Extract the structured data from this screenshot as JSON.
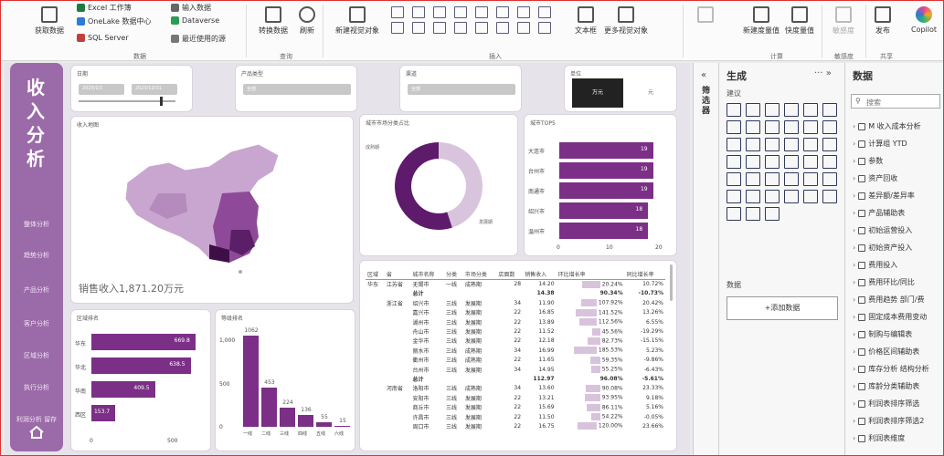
{
  "ribbon": {
    "get_data": "获取数据",
    "excel": "Excel 工作簿",
    "onelake": "OneLake 数据中心",
    "sql": "SQL Server",
    "enter_data": "输入数据",
    "dataverse": "Dataverse",
    "recent": "最近使用的源",
    "group_data": "数据",
    "transform": "转换数据",
    "refresh": "刷新",
    "group_query": "查询",
    "new_visual": "新建视觉对象",
    "group_insert": "插入",
    "textbox": "文本框",
    "more_visuals": "更多视觉对象",
    "quick_measure": "新建度量值",
    "quick_measure2": "快度量值",
    "group_calc": "计算",
    "sensitivity": "敏感度",
    "group_sens": "敏感度",
    "publish": "发布",
    "group_share": "共享",
    "copilot": "Copilot"
  },
  "nav": {
    "title": [
      "收",
      "入",
      "分",
      "析"
    ],
    "items": [
      "整体分析",
      "趋势分析",
      "产品分析",
      "客户分析",
      "区域分析",
      "执行分析",
      "利润分析 留存"
    ]
  },
  "slicers": {
    "date": {
      "title": "日期",
      "from": "2023/1/1",
      "to": "2023/12/31"
    },
    "product": {
      "title": "产品类型",
      "value": "全部"
    },
    "channel": {
      "title": "渠道",
      "value": "全部"
    },
    "unit": {
      "title": "单位",
      "selected": "万元",
      "other": "元"
    }
  },
  "map_card": {
    "title": "收入地图",
    "total_label": "销售收入1,871.20万元"
  },
  "donut_card": {
    "title": "城市市场分类占比",
    "label_a": "成熟期",
    "label_b": "发展期"
  },
  "top5_card": {
    "title": "城市TOP5"
  },
  "region_card": {
    "title": "区域排名"
  },
  "level_card": {
    "title": "等级排名"
  },
  "chart_data": [
    {
      "type": "bar",
      "title": "城市TOP5",
      "categories": [
        "大连市",
        "台州市",
        "南通市",
        "绍兴市",
        "温州市"
      ],
      "values": [
        19,
        19,
        19,
        18,
        18
      ],
      "xlim": [
        0,
        20
      ],
      "x_ticks": [
        "0",
        "10",
        "20"
      ]
    },
    {
      "type": "bar",
      "title": "区域排名",
      "categories": [
        "华东",
        "华北",
        "华南",
        "西区"
      ],
      "values": [
        669.8,
        638.5,
        409.5,
        153.7
      ],
      "x_ticks": [
        "0",
        "500"
      ]
    },
    {
      "type": "bar",
      "title": "等级排名",
      "categories": [
        "一线",
        "二线",
        "三线",
        "四线",
        "五线",
        "六线"
      ],
      "values": [
        1062,
        453,
        224,
        136,
        55,
        15
      ],
      "y_ticks": [
        "1,000",
        "500",
        "0"
      ],
      "ylim": [
        0,
        1100
      ]
    },
    {
      "type": "pie",
      "title": "城市市场分类占比",
      "categories": [
        "成熟期",
        "发展期"
      ],
      "values": [
        45,
        55
      ]
    }
  ],
  "table": {
    "headers": [
      "区域",
      "省",
      "城市名称",
      "分类",
      "市场分类",
      "店面数",
      "销售收入",
      "环比增长率",
      "同比增长率"
    ],
    "rows": [
      {
        "region": "华东",
        "prov": "江苏省",
        "city": "无锡市",
        "tier": "一线",
        "stage": "成熟期",
        "stores": "28",
        "rev": "14.20",
        "mom": "20.24%",
        "yoy": "10.72%",
        "w": 40
      },
      {
        "region": "",
        "prov": "",
        "city": "总计",
        "tier": "",
        "stage": "",
        "stores": "",
        "rev": "14.38",
        "mom": "90.34%",
        "yoy": "-10.73%",
        "w": 0,
        "sub": true
      },
      {
        "region": "",
        "prov": "浙江省",
        "city": "绍兴市",
        "tier": "三线",
        "stage": "发展期",
        "stores": "34",
        "rev": "11.90",
        "mom": "107.92%",
        "yoy": "20.42%",
        "w": 34
      },
      {
        "region": "",
        "prov": "",
        "city": "嘉兴市",
        "tier": "三线",
        "stage": "发展期",
        "stores": "22",
        "rev": "16.85",
        "mom": "141.52%",
        "yoy": "13.26%",
        "w": 46
      },
      {
        "region": "",
        "prov": "",
        "city": "湖州市",
        "tier": "三线",
        "stage": "发展期",
        "stores": "22",
        "rev": "13.89",
        "mom": "112.56%",
        "yoy": "6.55%",
        "w": 38
      },
      {
        "region": "",
        "prov": "",
        "city": "舟山市",
        "tier": "三线",
        "stage": "发展期",
        "stores": "22",
        "rev": "11.52",
        "mom": "45.56%",
        "yoy": "-19.29%",
        "w": 18
      },
      {
        "region": "",
        "prov": "",
        "city": "金华市",
        "tier": "三线",
        "stage": "发展期",
        "stores": "22",
        "rev": "12.18",
        "mom": "82.73%",
        "yoy": "-15.15%",
        "w": 28
      },
      {
        "region": "",
        "prov": "",
        "city": "丽水市",
        "tier": "三线",
        "stage": "成熟期",
        "stores": "34",
        "rev": "16.99",
        "mom": "185.53%",
        "yoy": "5.23%",
        "w": 50
      },
      {
        "region": "",
        "prov": "",
        "city": "衢州市",
        "tier": "三线",
        "stage": "成熟期",
        "stores": "22",
        "rev": "11.65",
        "mom": "59.35%",
        "yoy": "-9.86%",
        "w": 22
      },
      {
        "region": "",
        "prov": "",
        "city": "台州市",
        "tier": "三线",
        "stage": "发展期",
        "stores": "34",
        "rev": "14.95",
        "mom": "55.25%",
        "yoy": "-6.43%",
        "w": 20
      },
      {
        "region": "",
        "prov": "",
        "city": "总计",
        "tier": "",
        "stage": "",
        "stores": "",
        "rev": "112.97",
        "mom": "96.08%",
        "yoy": "-5.61%",
        "w": 0,
        "sub": true
      },
      {
        "region": "",
        "prov": "河南省",
        "city": "洛阳市",
        "tier": "三线",
        "stage": "成熟期",
        "stores": "34",
        "rev": "13.60",
        "mom": "90.08%",
        "yoy": "23.33%",
        "w": 32
      },
      {
        "region": "",
        "prov": "",
        "city": "安阳市",
        "tier": "三线",
        "stage": "发展期",
        "stores": "22",
        "rev": "13.21",
        "mom": "93.95%",
        "yoy": "9.18%",
        "w": 33
      },
      {
        "region": "",
        "prov": "",
        "city": "商丘市",
        "tier": "三线",
        "stage": "发展期",
        "stores": "22",
        "rev": "15.69",
        "mom": "86.11%",
        "yoy": "5.16%",
        "w": 30
      },
      {
        "region": "",
        "prov": "",
        "city": "许昌市",
        "tier": "三线",
        "stage": "发展期",
        "stores": "22",
        "rev": "11.50",
        "mom": "54.22%",
        "yoy": "-0.05%",
        "w": 20
      },
      {
        "region": "",
        "prov": "",
        "city": "周口市",
        "tier": "三线",
        "stage": "发展期",
        "stores": "22",
        "rev": "16.75",
        "mom": "120.00%",
        "yoy": "23.66%",
        "w": 42
      }
    ]
  },
  "filters_pane": {
    "label": "筛选器"
  },
  "build_pane": {
    "title": "生成",
    "suggest": "建议",
    "data_label": "数据",
    "add_data": "+添加数据"
  },
  "data_pane": {
    "title": "数据",
    "search_placeholder": "搜索",
    "fields": [
      "M 收入成本分析",
      "计算组 YTD",
      "参数",
      "资产回收",
      "差异额/差异率",
      "产品辅助表",
      "初始运营投入",
      "初始资产投入",
      "费用投入",
      "费用环比/同比",
      "费用趋势 部门/费",
      "固定成本费用变动",
      "制购与编辑表",
      "价格区间辅助表",
      "库存分析 结构分析",
      "库龄分类辅助表",
      "利润表排序筛选",
      "利润表排序筛选2",
      "利润表维度"
    ]
  },
  "colors": {
    "accent": "#7b2f86",
    "nav": "#9b6aa8"
  }
}
